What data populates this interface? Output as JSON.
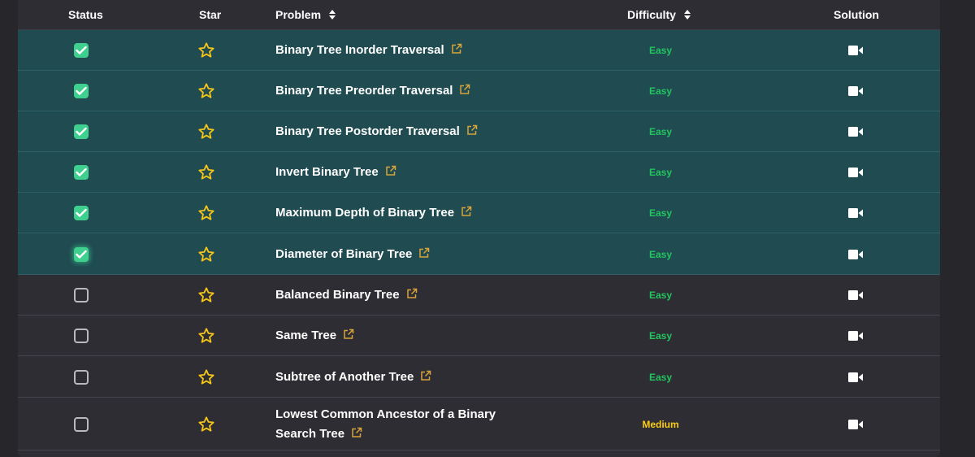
{
  "header": {
    "status": "Status",
    "star": "Star",
    "problem": "Problem",
    "difficulty": "Difficulty",
    "solution": "Solution"
  },
  "colors": {
    "easy": "#22c55e",
    "medium": "#facc15",
    "star": "#f5c518",
    "check": "#3fcf8e",
    "link": "#d8a43a"
  },
  "rows": [
    {
      "title": "Binary Tree Inorder Traversal",
      "difficulty": "Easy",
      "solved": true
    },
    {
      "title": "Binary Tree Preorder Traversal",
      "difficulty": "Easy",
      "solved": true
    },
    {
      "title": "Binary Tree Postorder Traversal",
      "difficulty": "Easy",
      "solved": true
    },
    {
      "title": "Invert Binary Tree",
      "difficulty": "Easy",
      "solved": true
    },
    {
      "title": "Maximum Depth of Binary Tree",
      "difficulty": "Easy",
      "solved": true
    },
    {
      "title": "Diameter of Binary Tree",
      "difficulty": "Easy",
      "solved": true
    },
    {
      "title": "Balanced Binary Tree",
      "difficulty": "Easy",
      "solved": false
    },
    {
      "title": "Same Tree",
      "difficulty": "Easy",
      "solved": false
    },
    {
      "title": "Subtree of Another Tree",
      "difficulty": "Easy",
      "solved": false
    },
    {
      "title": "Lowest Common Ancestor of a Binary Search Tree",
      "difficulty": "Medium",
      "solved": false
    }
  ]
}
